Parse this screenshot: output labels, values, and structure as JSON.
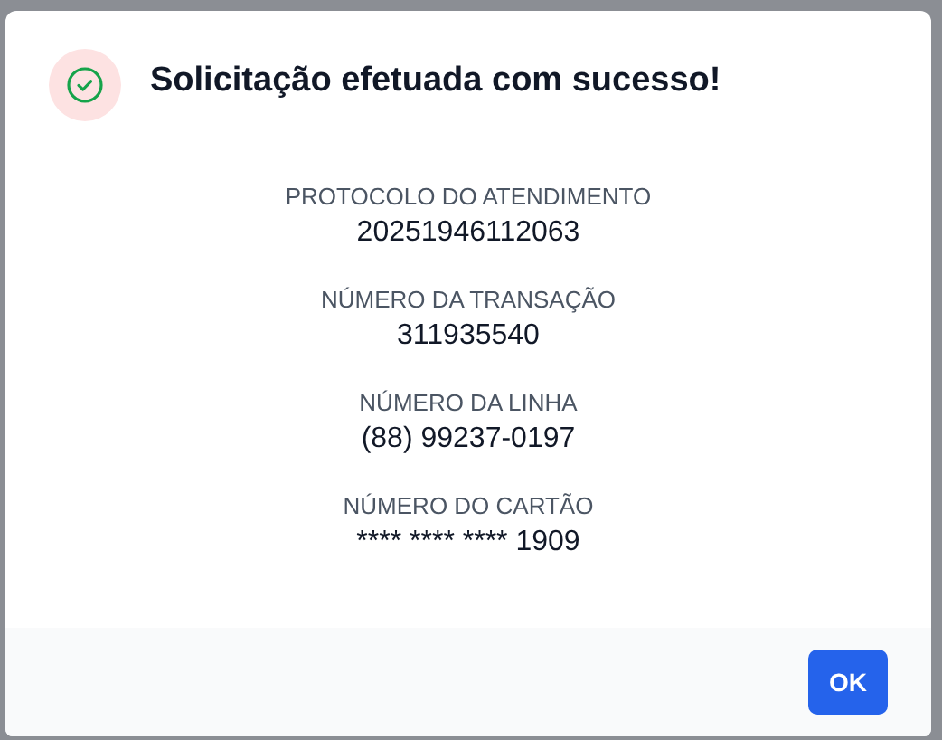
{
  "dialog": {
    "title": "Solicitação efetuada com sucesso!",
    "fields": [
      {
        "label": "PROTOCOLO DO ATENDIMENTO",
        "value": "20251946112063"
      },
      {
        "label": "NÚMERO DA TRANSAÇÃO",
        "value": "311935540"
      },
      {
        "label": "NÚMERO DA LINHA",
        "value": "(88) 99237-0197"
      },
      {
        "label": "NÚMERO DO CARTÃO",
        "value": "**** **** **** 1909"
      }
    ],
    "buttons": [
      "OK"
    ]
  }
}
